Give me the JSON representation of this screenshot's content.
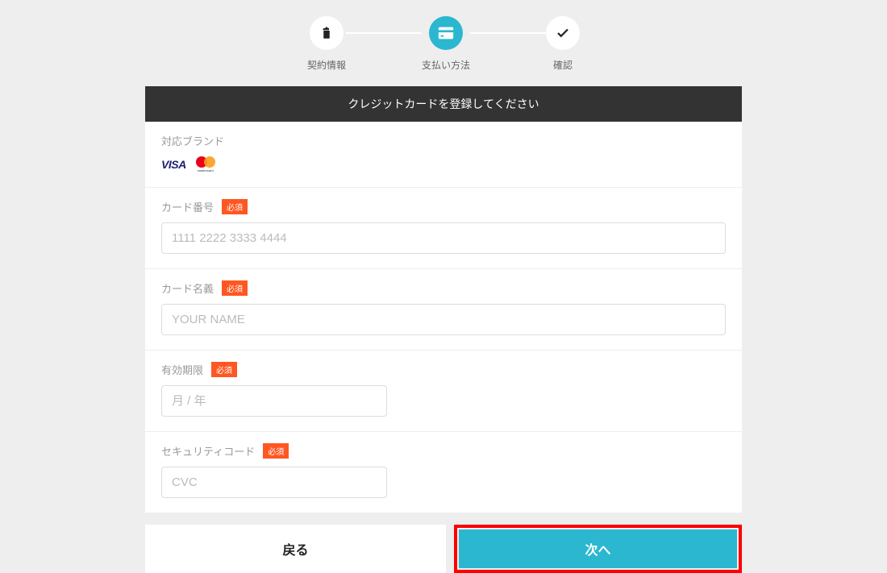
{
  "stepper": {
    "step1": {
      "label": "契約情報"
    },
    "step2": {
      "label": "支払い方法"
    },
    "step3": {
      "label": "確認"
    }
  },
  "form": {
    "header": "クレジットカードを登録してください",
    "brands": {
      "label": "対応ブランド",
      "visa_text": "VISA",
      "mc_text": "mastercard"
    },
    "required_badge": "必須",
    "card_number": {
      "label": "カード番号",
      "placeholder": "1111 2222 3333 4444"
    },
    "card_name": {
      "label": "カード名義",
      "placeholder": "YOUR NAME"
    },
    "expiry": {
      "label": "有効期限",
      "placeholder": "月 / 年"
    },
    "cvc": {
      "label": "セキュリティコード",
      "placeholder": "CVC"
    }
  },
  "buttons": {
    "back": "戻る",
    "next": "次へ"
  }
}
